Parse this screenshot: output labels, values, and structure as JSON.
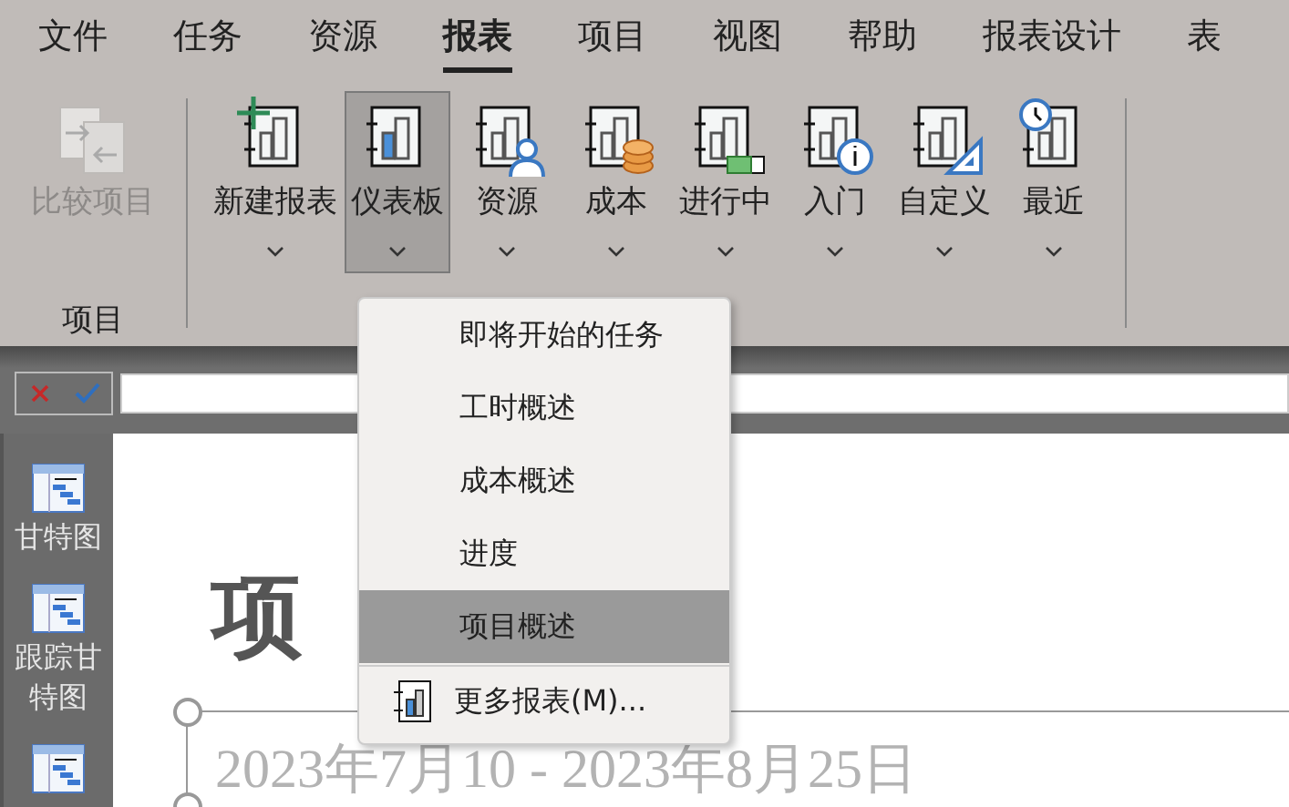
{
  "tabs": [
    {
      "label": "文件",
      "selected": false
    },
    {
      "label": "任务",
      "selected": false
    },
    {
      "label": "资源",
      "selected": false
    },
    {
      "label": "报表",
      "selected": true
    },
    {
      "label": "项目",
      "selected": false
    },
    {
      "label": "视图",
      "selected": false
    },
    {
      "label": "帮助",
      "selected": false
    },
    {
      "label": "报表设计",
      "selected": false
    },
    {
      "label": "表",
      "selected": false
    }
  ],
  "ribbon": {
    "project_group": {
      "label": "项目",
      "buttons": [
        {
          "label": "比较项目",
          "kind": "compare",
          "disabled": true
        }
      ]
    },
    "report_buttons": [
      {
        "label": "新建报表",
        "kind": "new",
        "pressed": false
      },
      {
        "label": "仪表板",
        "kind": "dashboard",
        "pressed": true
      },
      {
        "label": "资源",
        "kind": "resource",
        "pressed": false
      },
      {
        "label": "成本",
        "kind": "cost",
        "pressed": false
      },
      {
        "label": "进行中",
        "kind": "progress",
        "pressed": false
      },
      {
        "label": "入门",
        "kind": "info",
        "pressed": false
      },
      {
        "label": "自定义",
        "kind": "custom",
        "pressed": false
      },
      {
        "label": "最近",
        "kind": "recent",
        "pressed": false
      }
    ]
  },
  "sidebar": {
    "items": [
      {
        "kind": "labeled",
        "label": "甘特图"
      },
      {
        "kind": "labeled",
        "label": "跟踪甘特图"
      },
      {
        "kind": "icon"
      }
    ]
  },
  "report": {
    "title": "项",
    "date_range": "2023年7月10 - 2023年8月25日"
  },
  "dropdown": {
    "items": [
      {
        "label": "即将开始的任务",
        "selected": false
      },
      {
        "label": "工时概述",
        "selected": false
      },
      {
        "label": "成本概述",
        "selected": false
      },
      {
        "label": "进度",
        "selected": false
      },
      {
        "label": "项目概述",
        "selected": true
      }
    ],
    "more": "更多报表(M)..."
  }
}
